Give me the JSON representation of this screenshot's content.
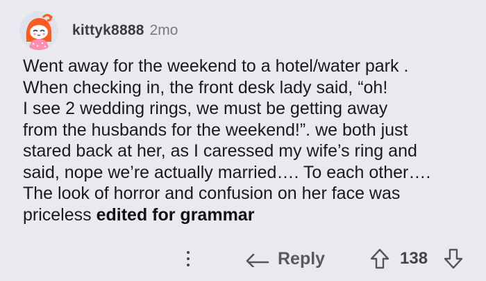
{
  "comment": {
    "author": "kittyk8888",
    "age": "2mo",
    "body_lines": [
      "Went away for the weekend to a hotel/water park .",
      "When checking in, the front desk lady said, “oh!",
      "I see 2 wedding rings, we must be getting away",
      "from the husbands for the weekend!”. we both just",
      "stared back at her, as I caressed my wife’s ring and",
      "said, nope we’re actually married…. To each other….",
      "The look of horror and confusion on her face was"
    ],
    "last_line_text": "priceless ",
    "edited_note": "edited for grammar",
    "avatar_icon": "snoo-avatar-icon"
  },
  "actions": {
    "more_icon": "more-options-icon",
    "reply_icon": "reply-arrow-icon",
    "reply_label": "Reply",
    "upvote_icon": "upvote-arrow-icon",
    "score": "138",
    "downvote_icon": "downvote-arrow-icon"
  },
  "colors": {
    "background": "#e9eaf0",
    "avatar_accent": "#ff5a1f"
  }
}
